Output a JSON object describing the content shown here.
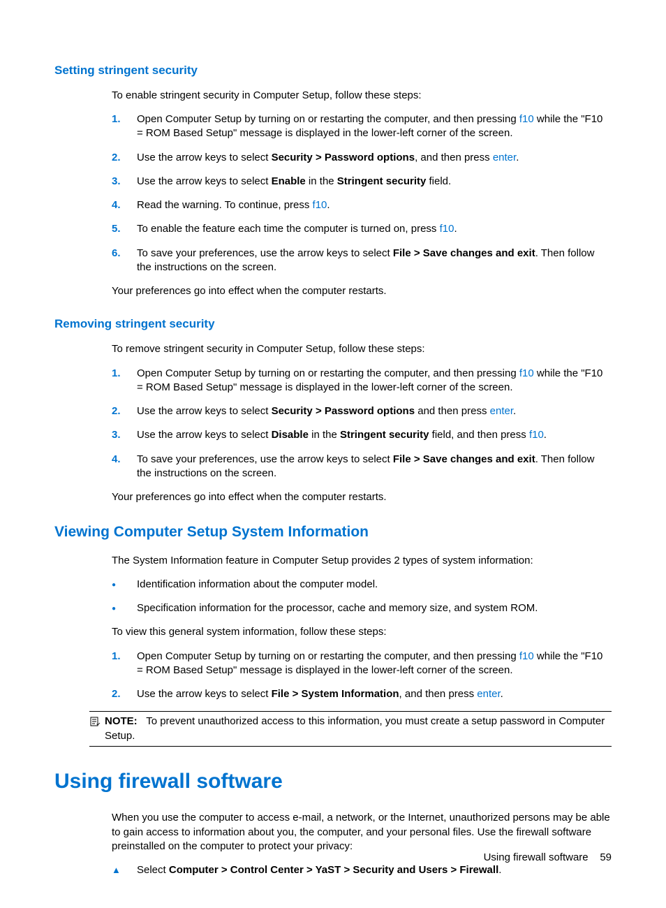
{
  "sections": {
    "setting": {
      "heading": "Setting stringent security",
      "intro": "To enable stringent security in Computer Setup, follow these steps:",
      "step1_pre": "Open Computer Setup by turning on or restarting the computer, and then pressing ",
      "step1_key": "f10",
      "step1_post": " while the \"F10 = ROM Based Setup\" message is displayed in the lower-left corner of the screen.",
      "step2_pre": "Use the arrow keys to select ",
      "step2_bold": "Security > Password options",
      "step2_mid": ", and then press ",
      "step2_key": "enter",
      "step2_post": ".",
      "step3_pre": "Use the arrow keys to select ",
      "step3_bold1": "Enable",
      "step3_mid": " in the ",
      "step3_bold2": "Stringent security",
      "step3_post": " field.",
      "step4_pre": "Read the warning. To continue, press ",
      "step4_key": "f10",
      "step4_post": ".",
      "step5_pre": "To enable the feature each time the computer is turned on, press ",
      "step5_key": "f10",
      "step5_post": ".",
      "step6_pre": "To save your preferences, use the arrow keys to select ",
      "step6_bold": "File > Save changes and exit",
      "step6_post": ". Then follow the instructions on the screen.",
      "outro": "Your preferences go into effect when the computer restarts."
    },
    "removing": {
      "heading": "Removing stringent security",
      "intro": "To remove stringent security in Computer Setup, follow these steps:",
      "step1_pre": "Open Computer Setup by turning on or restarting the computer, and then pressing ",
      "step1_key": "f10",
      "step1_post": " while the \"F10 = ROM Based Setup\" message is displayed in the lower-left corner of the screen.",
      "step2_pre": "Use the arrow keys to select ",
      "step2_bold": "Security > Password options",
      "step2_mid": " and then press ",
      "step2_key": "enter",
      "step2_post": ".",
      "step3_pre": "Use the arrow keys to select ",
      "step3_bold1": "Disable",
      "step3_mid": " in the ",
      "step3_bold2": "Stringent security",
      "step3_post1": " field, and then press ",
      "step3_key": "f10",
      "step3_post2": ".",
      "step4_pre": "To save your preferences, use the arrow keys to select ",
      "step4_bold": "File > Save changes and exit",
      "step4_post": ". Then follow the instructions on the screen.",
      "outro": "Your preferences go into effect when the computer restarts."
    },
    "viewing": {
      "heading": "Viewing Computer Setup System Information",
      "intro": "The System Information feature in Computer Setup provides 2 types of system information:",
      "bullet1": "Identification information about the computer model.",
      "bullet2": "Specification information for the processor, cache and memory size, and system ROM.",
      "instr": "To view this general system information, follow these steps:",
      "step1_pre": "Open Computer Setup by turning on or restarting the computer, and then pressing ",
      "step1_key": "f10",
      "step1_post": " while the \"F10 = ROM Based Setup\" message is displayed in the lower-left corner of the screen.",
      "step2_pre": "Use the arrow keys to select ",
      "step2_bold": "File > System Information",
      "step2_mid": ", and then press ",
      "step2_key": "enter",
      "step2_post": ".",
      "note_label": "NOTE:",
      "note_text": "To prevent unauthorized access to this information, you must create a setup password in Computer Setup."
    },
    "firewall": {
      "heading": "Using firewall software",
      "intro": "When you use the computer to access e-mail, a network, or the Internet, unauthorized persons may be able to gain access to information about you, the computer, and your personal files. Use the firewall software preinstalled on the computer to protect your privacy:",
      "action_pre": "Select ",
      "action_bold": "Computer > Control Center > YaST > Security and Users > Firewall",
      "action_post": "."
    }
  },
  "nums": {
    "n1": "1.",
    "n2": "2.",
    "n3": "3.",
    "n4": "4.",
    "n5": "5.",
    "n6": "6."
  },
  "footer": {
    "text": "Using firewall software",
    "page": "59"
  }
}
